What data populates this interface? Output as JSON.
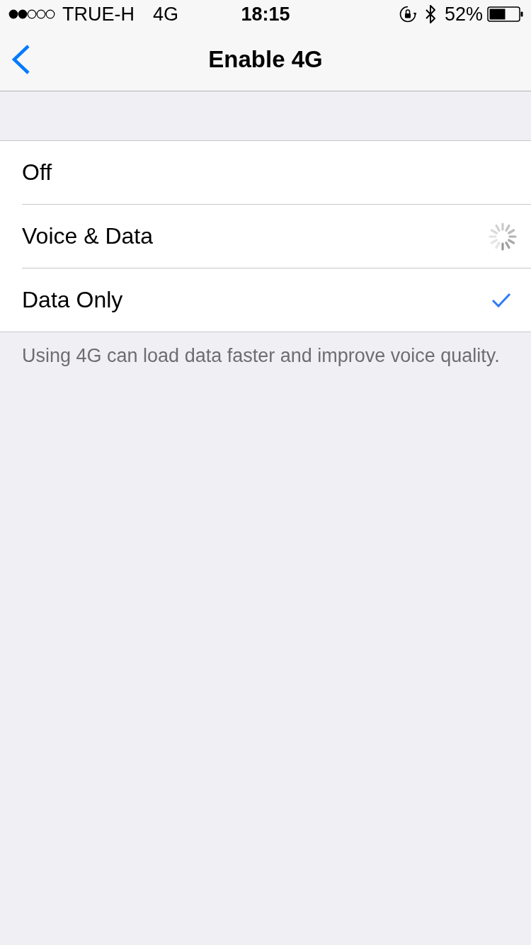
{
  "status_bar": {
    "carrier": "TRUE-H",
    "network": "4G",
    "time": "18:15",
    "battery": "52%"
  },
  "nav_bar": {
    "title": "Enable 4G"
  },
  "options": [
    {
      "label": "Off",
      "selected": false,
      "loading": false
    },
    {
      "label": "Voice & Data",
      "selected": false,
      "loading": true
    },
    {
      "label": "Data Only",
      "selected": true,
      "loading": false
    }
  ],
  "footer": "Using 4G can load data faster and improve voice quality."
}
